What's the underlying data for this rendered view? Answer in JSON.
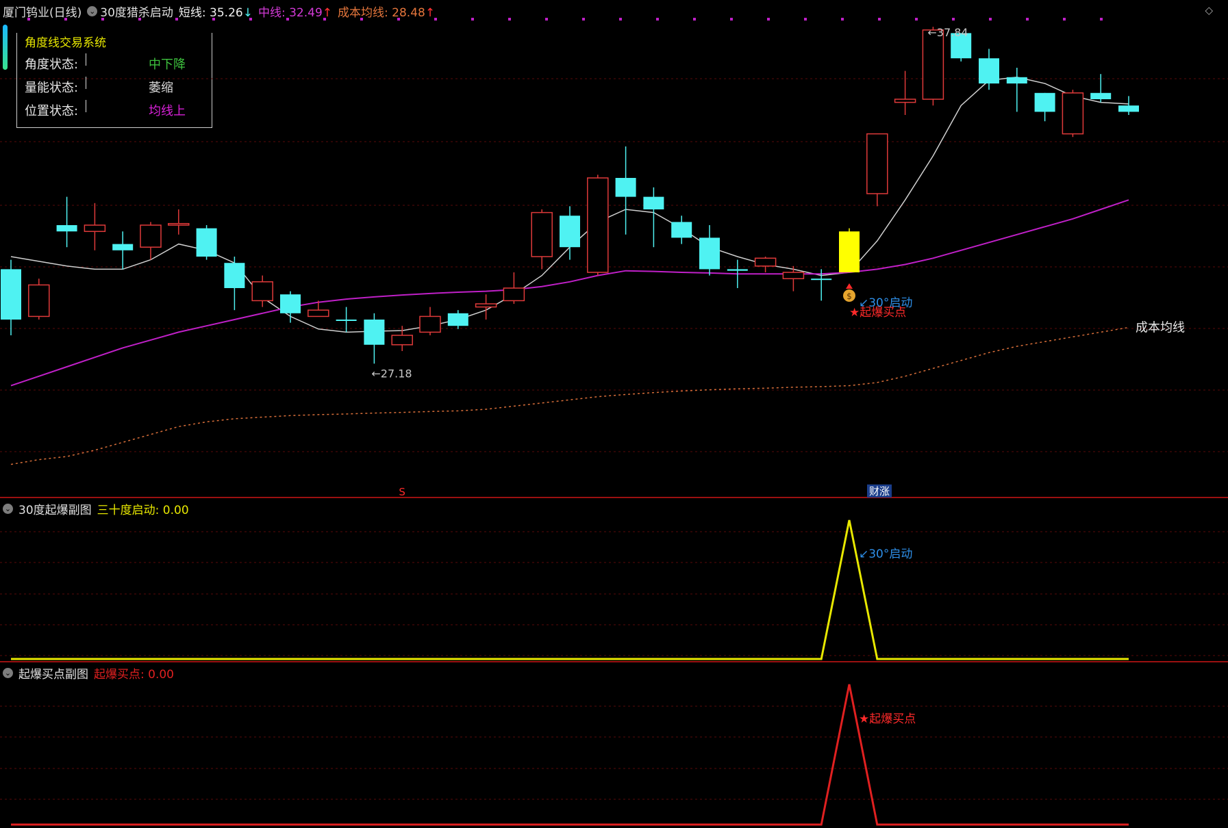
{
  "header": {
    "stock_title": "厦门钨业(日线)",
    "indicator_name": "30度猎杀启动",
    "short_label": "短线:",
    "short_value": "35.26",
    "short_arrow": "↓",
    "mid_label": "中线:",
    "mid_value": "32.49",
    "mid_arrow": "↑",
    "cost_label": "成本均线:",
    "cost_value": "28.48",
    "cost_arrow": "↑",
    "top_right_icon": "diamond-icon"
  },
  "infobox": {
    "title": "角度线交易系统",
    "rows": [
      {
        "label": "角度状态:",
        "value": "中下降",
        "color": "#3ec23e"
      },
      {
        "label": "量能状态:",
        "value": "萎缩",
        "color": "#d8d8d8"
      },
      {
        "label": "位置状态:",
        "value": "均线上",
        "color": "#d820d8"
      }
    ]
  },
  "colors": {
    "up": "#e03a3a",
    "down": "#4ff2f2",
    "signal": "#ffff00",
    "short_line": "#d0d0d0",
    "mid_line": "#c020c8",
    "cost_line": "#d96f3a",
    "grid": "#5a0a0a",
    "separator": "#9b1010",
    "sub1_line": "#e8e800",
    "sub2_line": "#e02020"
  },
  "chart_data": [
    {
      "type": "candlestick",
      "title": "厦门钨业(日线)",
      "ylim": [
        24.5,
        39.5
      ],
      "grid": true,
      "candles": [
        {
          "o": 31.6,
          "c": 30.0,
          "h": 31.9,
          "l": 29.5
        },
        {
          "o": 30.1,
          "c": 31.1,
          "h": 31.3,
          "l": 30.0
        },
        {
          "o": 33.0,
          "c": 32.8,
          "h": 33.9,
          "l": 32.3
        },
        {
          "o": 32.8,
          "c": 33.0,
          "h": 33.7,
          "l": 32.2
        },
        {
          "o": 32.4,
          "c": 32.2,
          "h": 32.8,
          "l": 31.6
        },
        {
          "o": 32.3,
          "c": 33.0,
          "h": 33.1,
          "l": 31.9
        },
        {
          "o": 33.0,
          "c": 33.05,
          "h": 33.5,
          "l": 32.7
        },
        {
          "o": 32.9,
          "c": 32.0,
          "h": 33.0,
          "l": 31.9
        },
        {
          "o": 31.8,
          "c": 31.0,
          "h": 32.0,
          "l": 30.3
        },
        {
          "o": 30.6,
          "c": 31.2,
          "h": 31.4,
          "l": 30.4
        },
        {
          "o": 30.8,
          "c": 30.2,
          "h": 30.9,
          "l": 29.9
        },
        {
          "o": 30.1,
          "c": 30.3,
          "h": 30.6,
          "l": 30.1
        },
        {
          "o": 30.0,
          "c": 29.97,
          "h": 30.4,
          "l": 29.6
        },
        {
          "o": 30.0,
          "c": 29.2,
          "h": 30.2,
          "l": 28.6
        },
        {
          "o": 29.2,
          "c": 29.5,
          "h": 29.8,
          "l": 29.0
        },
        {
          "o": 29.6,
          "c": 30.1,
          "h": 30.4,
          "l": 29.5
        },
        {
          "o": 30.2,
          "c": 29.8,
          "h": 30.3,
          "l": 29.7
        },
        {
          "o": 30.4,
          "c": 30.5,
          "h": 30.8,
          "l": 30.0
        },
        {
          "o": 30.6,
          "c": 31.0,
          "h": 31.5,
          "l": 30.5
        },
        {
          "o": 32.0,
          "c": 33.4,
          "h": 33.5,
          "l": 31.6
        },
        {
          "o": 33.3,
          "c": 32.3,
          "h": 33.6,
          "l": 31.9
        },
        {
          "o": 31.5,
          "c": 34.5,
          "h": 34.6,
          "l": 31.4
        },
        {
          "o": 34.5,
          "c": 33.9,
          "h": 35.5,
          "l": 32.7
        },
        {
          "o": 33.9,
          "c": 33.5,
          "h": 34.2,
          "l": 32.3
        },
        {
          "o": 33.1,
          "c": 32.6,
          "h": 33.3,
          "l": 32.4
        },
        {
          "o": 32.6,
          "c": 31.6,
          "h": 33.0,
          "l": 31.4
        },
        {
          "o": 31.6,
          "c": 31.55,
          "h": 31.9,
          "l": 31.0
        },
        {
          "o": 31.7,
          "c": 31.95,
          "h": 32.0,
          "l": 31.5
        },
        {
          "o": 31.3,
          "c": 31.5,
          "h": 31.7,
          "l": 30.9
        },
        {
          "o": 31.3,
          "c": 31.28,
          "h": 31.6,
          "l": 30.6
        },
        {
          "o": 31.5,
          "c": 32.8,
          "h": 32.9,
          "l": 31.5,
          "signal": true
        },
        {
          "o": 34.0,
          "c": 35.9,
          "h": 35.9,
          "l": 33.6
        },
        {
          "o": 36.9,
          "c": 37.0,
          "h": 37.9,
          "l": 36.5
        },
        {
          "o": 37.0,
          "c": 39.2,
          "h": 39.3,
          "l": 36.8
        },
        {
          "o": 39.1,
          "c": 38.3,
          "h": 39.1,
          "l": 38.2
        },
        {
          "o": 38.3,
          "c": 37.5,
          "h": 38.6,
          "l": 37.3
        },
        {
          "o": 37.7,
          "c": 37.5,
          "h": 38.0,
          "l": 36.6
        },
        {
          "o": 37.2,
          "c": 36.6,
          "h": 37.2,
          "l": 36.3
        },
        {
          "o": 35.9,
          "c": 37.2,
          "h": 37.3,
          "l": 35.8
        },
        {
          "o": 37.2,
          "c": 37.0,
          "h": 37.8,
          "l": 36.9
        },
        {
          "o": 36.8,
          "c": 36.6,
          "h": 37.1,
          "l": 36.5
        }
      ],
      "series": [
        {
          "name": "短线",
          "values": [
            32.0,
            31.85,
            31.7,
            31.6,
            31.6,
            31.9,
            32.4,
            32.2,
            31.8,
            30.7,
            30.1,
            29.7,
            29.6,
            29.63,
            29.65,
            29.8,
            30.0,
            30.3,
            30.8,
            31.4,
            32.3,
            33.1,
            33.5,
            33.4,
            32.9,
            32.3,
            32.0,
            31.75,
            31.6,
            31.4,
            31.5,
            32.5,
            33.8,
            35.2,
            36.8,
            37.6,
            37.7,
            37.5,
            37.1,
            36.9,
            36.85
          ]
        },
        {
          "name": "中线",
          "values": [
            27.9,
            28.2,
            28.5,
            28.8,
            29.1,
            29.35,
            29.6,
            29.8,
            30.0,
            30.2,
            30.4,
            30.55,
            30.65,
            30.72,
            30.78,
            30.83,
            30.87,
            30.9,
            30.95,
            31.05,
            31.2,
            31.4,
            31.55,
            31.53,
            31.5,
            31.48,
            31.45,
            31.45,
            31.45,
            31.45,
            31.5,
            31.6,
            31.75,
            31.95,
            32.2,
            32.45,
            32.7,
            32.95,
            33.2,
            33.5,
            33.8
          ]
        },
        {
          "name": "成本均线",
          "values": [
            25.4,
            25.55,
            25.65,
            25.85,
            26.1,
            26.35,
            26.6,
            26.75,
            26.85,
            26.9,
            26.95,
            26.98,
            27.0,
            27.03,
            27.05,
            27.08,
            27.1,
            27.15,
            27.25,
            27.35,
            27.45,
            27.55,
            27.62,
            27.68,
            27.73,
            27.77,
            27.8,
            27.82,
            27.85,
            27.87,
            27.9,
            28.0,
            28.2,
            28.45,
            28.7,
            28.95,
            29.15,
            29.3,
            29.45,
            29.6,
            29.75
          ]
        }
      ],
      "annotations": {
        "high": "37.84",
        "low": "27.18",
        "cost_line_label": "成本均线",
        "signal_text": "30°启动",
        "buy_text": "★起爆买点",
        "markers": [
          "S",
          "财涨"
        ]
      }
    },
    {
      "type": "line",
      "title": "30度起爆副图",
      "series": [
        {
          "name": "三十度启动",
          "current": "0.00",
          "values": [
            0,
            0,
            0,
            0,
            0,
            0,
            0,
            0,
            0,
            0,
            0,
            0,
            0,
            0,
            0,
            0,
            0,
            0,
            0,
            0,
            0,
            0,
            0,
            0,
            0,
            0,
            0,
            0,
            0,
            0,
            1,
            0,
            0,
            0,
            0,
            0,
            0,
            0,
            0,
            0,
            0
          ]
        }
      ],
      "annotation": "30°启动"
    },
    {
      "type": "line",
      "title": "起爆买点副图",
      "series": [
        {
          "name": "起爆买点",
          "current": "0.00",
          "values": [
            0,
            0,
            0,
            0,
            0,
            0,
            0,
            0,
            0,
            0,
            0,
            0,
            0,
            0,
            0,
            0,
            0,
            0,
            0,
            0,
            0,
            0,
            0,
            0,
            0,
            0,
            0,
            0,
            0,
            0,
            1,
            0,
            0,
            0,
            0,
            0,
            0,
            0,
            0,
            0,
            0
          ]
        }
      ],
      "annotation": "★起爆买点"
    }
  ]
}
